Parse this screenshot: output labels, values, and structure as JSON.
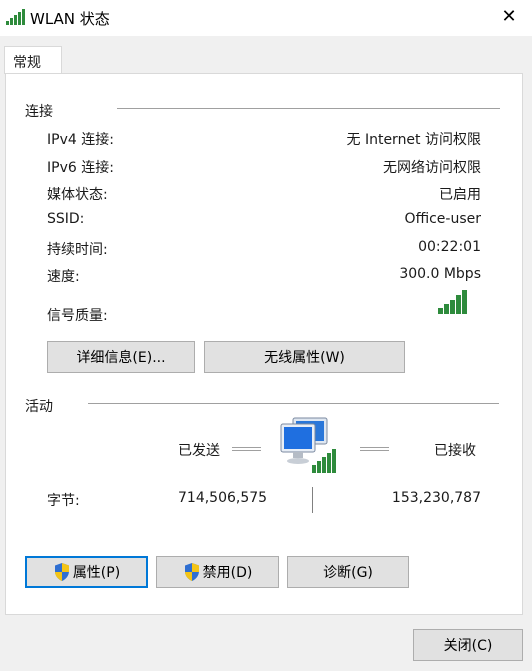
{
  "window": {
    "title": "WLAN 状态",
    "close_label": "✕"
  },
  "tab": {
    "label": "常规"
  },
  "connection": {
    "section_title": "连接",
    "rows": [
      {
        "label": "IPv4 连接:",
        "value": "无 Internet 访问权限"
      },
      {
        "label": "IPv6 连接:",
        "value": "无网络访问权限"
      },
      {
        "label": "媒体状态:",
        "value": "已启用"
      },
      {
        "label": "SSID:",
        "value": "Office-user"
      },
      {
        "label": "持续时间:",
        "value": "00:22:01"
      },
      {
        "label": "速度:",
        "value": "300.0 Mbps"
      }
    ],
    "signal_label": "信号质量:",
    "signal_bars": 5,
    "details_button": "详细信息(E)...",
    "wireless_button": "无线属性(W)"
  },
  "activity": {
    "section_title": "活动",
    "sent_label": "已发送",
    "received_label": "已接收",
    "bytes_label": "字节:",
    "bytes_sent": "714,506,575",
    "bytes_received": "153,230,787"
  },
  "buttons": {
    "properties": "属性(P)",
    "disable": "禁用(D)",
    "diagnose": "诊断(G)",
    "close": "关闭(C)"
  },
  "colors": {
    "signal_green": "#2e8b3c",
    "accent_blue": "#0078d7",
    "shield_blue": "#2f6fd1",
    "shield_yellow": "#f3c417"
  }
}
